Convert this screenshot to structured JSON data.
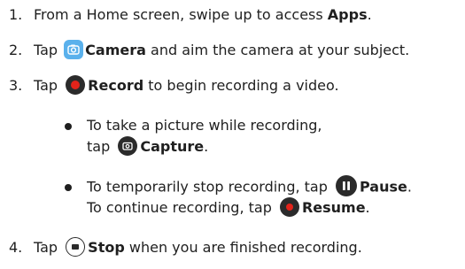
{
  "steps": [
    {
      "number": "1.",
      "text_before": "From a Home screen, swipe up to access ",
      "bold": "Apps",
      "text_after": "."
    },
    {
      "number": "2.",
      "text_before": "Tap ",
      "icon": "camera-app-icon",
      "bold": "Camera",
      "text_after": " and aim the camera at your subject."
    },
    {
      "number": "3.",
      "text_before": "Tap ",
      "icon": "record-icon",
      "bold": "Record",
      "text_after": " to begin recording a video."
    },
    {
      "number": "4.",
      "text_before": "Tap ",
      "icon": "stop-icon",
      "bold": "Stop",
      "text_after": " when you are finished recording."
    }
  ],
  "sub_bullets": [
    {
      "line1": "To take a picture while recording,",
      "line2_before": "tap ",
      "icon": "capture-icon",
      "bold": "Capture",
      "line2_after": "."
    },
    {
      "line1_before": "To temporarily stop recording, tap ",
      "icon1": "pause-icon",
      "bold1": "Pause",
      "line1_after": ".",
      "line2_before": "To continue recording, tap ",
      "icon2": "resume-icon",
      "bold2": "Resume",
      "line2_after": "."
    }
  ],
  "colors": {
    "text": "#1f1f1f",
    "record_red": "#e2231a",
    "camera_blue": "#5ab1ec",
    "icon_dark": "#2b2b2b"
  }
}
